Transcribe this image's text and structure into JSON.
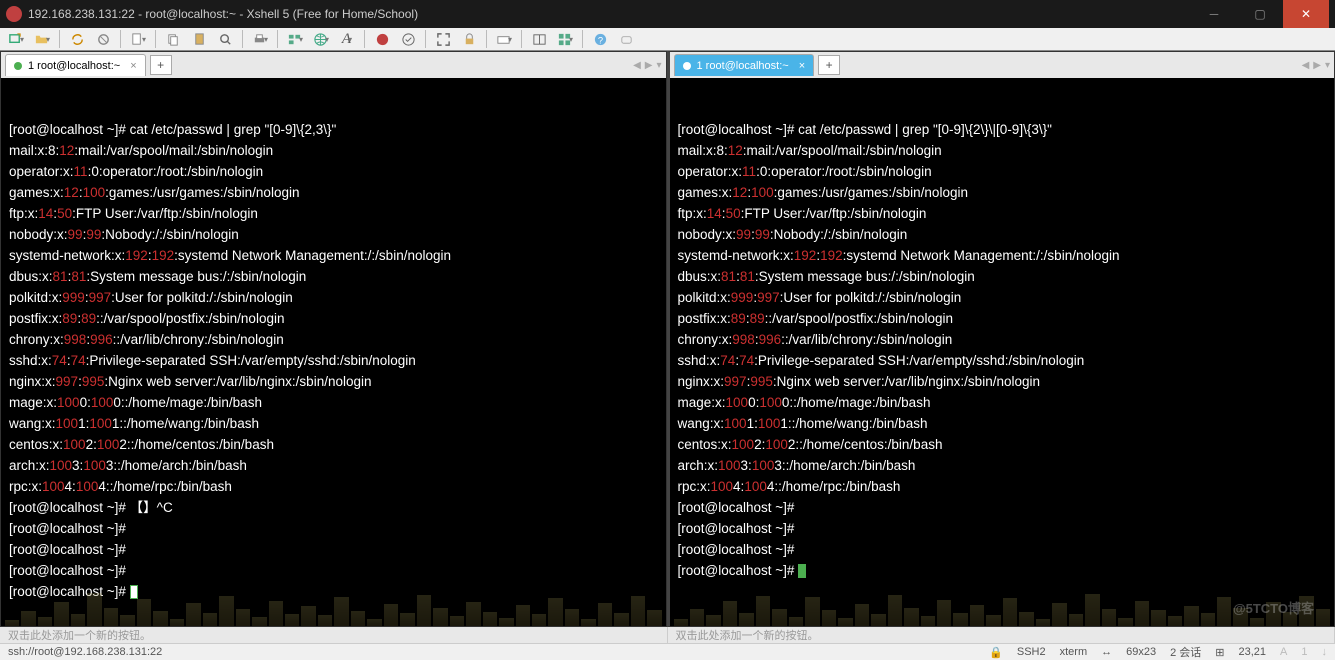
{
  "window": {
    "title": "192.168.238.131:22 - root@localhost:~ - Xshell 5 (Free for Home/School)"
  },
  "tabs": {
    "left": "1 root@localhost:~",
    "right": "1 root@localhost:~"
  },
  "left_terminal": {
    "cmd": "[root@localhost ~]# cat /etc/passwd | grep \"[0-9]\\{2,3\\}\"",
    "l1_a": "mail:x:8:",
    "l1_b": "12",
    "l1_c": ":mail:/var/spool/mail:/sbin/nologin",
    "l2_a": "operator:x:",
    "l2_b": "11",
    "l2_c": ":0:operator:/root:/sbin/nologin",
    "l3_a": "games:x:",
    "l3_b": "12",
    "l3_c": ":",
    "l3_d": "100",
    "l3_e": ":games:/usr/games:/sbin/nologin",
    "l4_a": "ftp:x:",
    "l4_b": "14",
    "l4_c": ":",
    "l4_d": "50",
    "l4_e": ":FTP User:/var/ftp:/sbin/nologin",
    "l5_a": "nobody:x:",
    "l5_b": "99",
    "l5_c": ":",
    "l5_d": "99",
    "l5_e": ":Nobody:/:/sbin/nologin",
    "l6_a": "systemd-network:x:",
    "l6_b": "192",
    "l6_c": ":",
    "l6_d": "192",
    "l6_e": ":systemd Network Management:/:/sbin/nologin",
    "l7_a": "dbus:x:",
    "l7_b": "81",
    "l7_c": ":",
    "l7_d": "81",
    "l7_e": ":System message bus:/:/sbin/nologin",
    "l8_a": "polkitd:x:",
    "l8_b": "999",
    "l8_c": ":",
    "l8_d": "997",
    "l8_e": ":User for polkitd:/:/sbin/nologin",
    "l9_a": "postfix:x:",
    "l9_b": "89",
    "l9_c": ":",
    "l9_d": "89",
    "l9_e": "::/var/spool/postfix:/sbin/nologin",
    "l10_a": "chrony:x:",
    "l10_b": "998",
    "l10_c": ":",
    "l10_d": "996",
    "l10_e": "::/var/lib/chrony:/sbin/nologin",
    "l11_a": "sshd:x:",
    "l11_b": "74",
    "l11_c": ":",
    "l11_d": "74",
    "l11_e": ":Privilege-separated SSH:/var/empty/sshd:/sbin/nologin",
    "l12_a": "nginx:x:",
    "l12_b": "997",
    "l12_c": ":",
    "l12_d": "995",
    "l12_e": ":Nginx web server:/var/lib/nginx:/sbin/nologin",
    "l13_a": "mage:x:",
    "l13_b": "100",
    "l13_c": "0:",
    "l13_d": "100",
    "l13_e": "0::/home/mage:/bin/bash",
    "l14_a": "wang:x:",
    "l14_b": "100",
    "l14_c": "1:",
    "l14_d": "100",
    "l14_e": "1::/home/wang:/bin/bash",
    "l15_a": "centos:x:",
    "l15_b": "100",
    "l15_c": "2:",
    "l15_d": "100",
    "l15_e": "2::/home/centos:/bin/bash",
    "l16_a": "arch:x:",
    "l16_b": "100",
    "l16_c": "3:",
    "l16_d": "100",
    "l16_e": "3::/home/arch:/bin/bash",
    "l17_a": "rpc:x:",
    "l17_b": "100",
    "l17_c": "4:",
    "l17_d": "100",
    "l17_e": "4::/home/rpc:/bin/bash",
    "p1": "[root@localhost ~]# 【】^C",
    "p2": "[root@localhost ~]#",
    "p3": "[root@localhost ~]#",
    "p4": "[root@localhost ~]#",
    "p5": "[root@localhost ~]# "
  },
  "right_terminal": {
    "cmd": "[root@localhost ~]# cat /etc/passwd | grep \"[0-9]\\{2\\}\\|[0-9]\\{3\\}\"",
    "p1": "[root@localhost ~]#",
    "p2": "[root@localhost ~]#",
    "p3": "[root@localhost ~]#",
    "p4": "[root@localhost ~]# "
  },
  "quickbar": {
    "hint": "双击此处添加一个新的按钮。"
  },
  "statusbar": {
    "conn": "ssh://root@192.168.238.131:22",
    "ssh": "SSH2",
    "term": "xterm",
    "size": "69x23",
    "sessions": "2 会话",
    "pos": "23,21",
    "watermark": "@5TCTO博客"
  }
}
